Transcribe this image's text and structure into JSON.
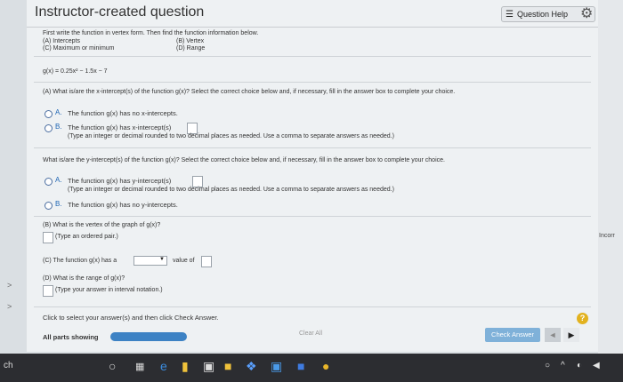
{
  "header": {
    "title": "Instructor-created question",
    "help_label": "Question Help"
  },
  "intro": {
    "line": "First write the function in vertex form. Then find the function information below.",
    "parts": [
      "(A) Intercepts",
      "(B) Vertex",
      "(C) Maximum or minimum",
      "(D) Range"
    ],
    "function": "g(x) = 0.25x² − 1.5x − 7"
  },
  "part_a": {
    "question": "(A) What is/are the x-intercept(s) of the function g(x)? Select the correct choice below and, if necessary, fill in the answer box to complete your choice.",
    "option_a_letter": "A.",
    "option_a_text": "The function g(x) has no x-intercepts.",
    "option_b_letter": "B.",
    "option_b_text": "The function g(x) has x-intercept(s)",
    "option_b_hint": "(Type an integer or decimal rounded to two decimal places as needed. Use a comma to separate answers as needed.)"
  },
  "part_y": {
    "question": "What is/are the y-intercept(s) of the function g(x)? Select the correct choice below and, if necessary, fill in the answer box to complete your choice.",
    "option_a_letter": "A.",
    "option_a_text": "The function g(x) has y-intercept(s)",
    "option_a_hint": "(Type an integer or decimal rounded to two decimal places as needed. Use a comma to separate answers as needed.)",
    "option_b_letter": "B.",
    "option_b_text": "The function g(x) has no y-intercepts."
  },
  "part_b": {
    "question": "(B) What is the vertex of the graph of g(x)?",
    "hint": "(Type an ordered pair.)"
  },
  "part_c": {
    "prefix": "(C) The function g(x) has a",
    "suffix": "value of"
  },
  "part_d": {
    "question": "(D) What is the range of g(x)?",
    "hint": "(Type your answer in interval notation.)"
  },
  "footer": {
    "instruction": "Click to select your answer(s) and then click Check Answer.",
    "help_symbol": "?",
    "parts_label": "All parts showing",
    "clear_label": "Clear All",
    "check_label": "Check Answer",
    "prev_symbol": "◄",
    "next_symbol": "▶"
  },
  "side": {
    "right_label": "Incorr",
    "left_chevron": ">"
  },
  "taskbar": {
    "left_text": "ch"
  },
  "colors": {
    "accent": "#3d82c4",
    "check_button": "#7fb1d9",
    "help_icon": "#e2b21f"
  }
}
